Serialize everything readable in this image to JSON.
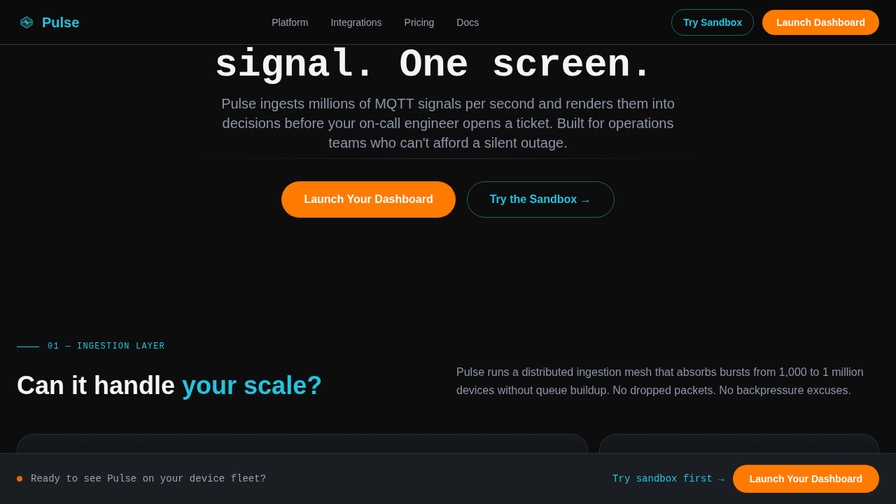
{
  "nav": {
    "brand": "Pulse",
    "links": [
      "Platform",
      "Integrations",
      "Pricing",
      "Docs"
    ],
    "buttons": [
      {
        "label": "Try Sandbox",
        "kind": "outline"
      },
      {
        "label": "Launch Dashboard",
        "kind": "primary"
      }
    ]
  },
  "hero": {
    "title": "signal. One screen.",
    "description": "Pulse ingests millions of MQTT signals per second and renders them into decisions before your on-call engineer opens a ticket. Built for operations teams who can't afford a silent outage.",
    "buttons": [
      {
        "label": "Launch Your Dashboard",
        "kind": "primary"
      },
      {
        "label": "Try the Sandbox →",
        "kind": "outline"
      }
    ]
  },
  "section": {
    "eyebrow": "01 — INGESTION LAYER",
    "heading": {
      "lead": "Can it handle",
      "accent": "your scale?"
    },
    "description": "Pulse runs a distributed ingestion mesh that absorbs bursts from 1,000 to 1 million devices without queue buildup. No dropped packets. No backpressure excuses."
  },
  "cta_bar": {
    "message": "Ready to see Pulse on your device fleet?",
    "link": "Try sandbox first →",
    "button": {
      "label": "Launch Your Dashboard",
      "kind": "primary"
    }
  }
}
